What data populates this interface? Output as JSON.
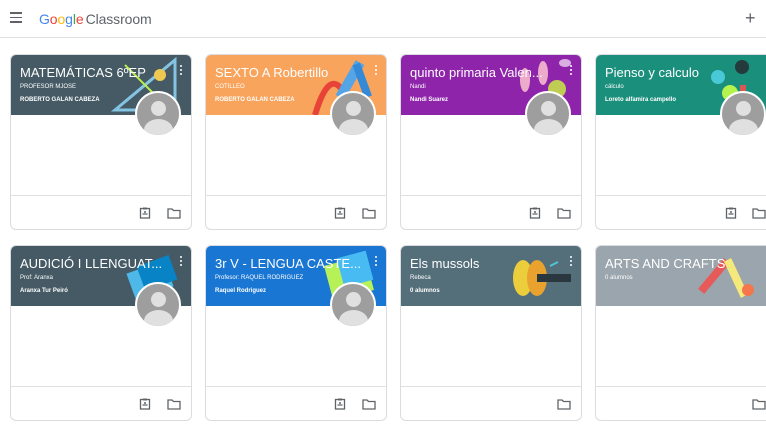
{
  "app": {
    "brand_letters": [
      "G",
      "o",
      "o",
      "g",
      "l",
      "e"
    ],
    "brand_suffix": "Classroom"
  },
  "classes": [
    {
      "title": "MATEMÁTICAS 6ºEP",
      "section": "PROFESOR MJOSE",
      "teacher": "ROBERTO GALAN CABEZA",
      "color": "#455a64",
      "deco": "geometry-icon",
      "has_work": true
    },
    {
      "title": "SEXTO A Robertillo",
      "section": "COTILLEO",
      "teacher": "ROBERTO GALAN CABEZA",
      "color": "#f9a45c",
      "deco": "paint-icon",
      "has_work": true
    },
    {
      "title": "quinto primaria Valen...",
      "section": "Nandi",
      "teacher": "Nandi Suarez",
      "color": "#8e24aa",
      "deco": "bowling-icon",
      "has_work": true
    },
    {
      "title": "Pienso y calculo",
      "section": "cálculo",
      "teacher": "Loreto alfamira campello",
      "color": "#1a8f7c",
      "deco": "balls-icon",
      "has_work": true
    },
    {
      "title": "AUDICIÓ I LLENGUAT...",
      "section": "Prof: Aranxa",
      "teacher": "Aranxa Tur Peiró",
      "color": "#455a64",
      "deco": "books-icon",
      "has_work": true
    },
    {
      "title": "3r V - LENGUA CASTE...",
      "section": "Profesor: RAQUEL RODRIGUEZ",
      "teacher": "Raquel Rodriguez",
      "color": "#1976d2",
      "deco": "notebook-icon",
      "has_work": true
    },
    {
      "title": "Els mussols",
      "section": "Rebeca",
      "teacher": "0 alumnos",
      "color": "#546e7a",
      "deco": "tape-icon",
      "has_work": false
    },
    {
      "title": "ARTS AND CRAFTS",
      "section": "0 alumnos",
      "teacher": "",
      "color": "#9aa5ad",
      "deco": "crafts-icon",
      "has_work": false
    }
  ]
}
